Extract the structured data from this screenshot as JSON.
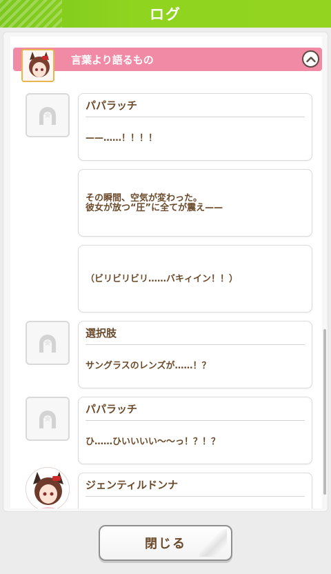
{
  "header": {
    "title": "ログ"
  },
  "chapter": {
    "title": "言葉より語るもの"
  },
  "entries": [
    {
      "speaker": "パパラッチ",
      "text": "——……！！！！"
    },
    {
      "speaker": "",
      "text": "その瞬間、空気が変わった。\n彼女が放つ“圧”に全てが震え——"
    },
    {
      "speaker": "",
      "text": "（ビリビリビリ……バキィイン！！）"
    },
    {
      "speaker": "選択肢",
      "text": "サングラスのレンズが……！？"
    },
    {
      "speaker": "パパラッチ",
      "text": "ひ……ひいいいい～～っ！？！？"
    },
    {
      "speaker": "ジェンティルドンナ",
      "text": ""
    }
  ],
  "footer": {
    "close_label": "閉じる"
  },
  "colors": {
    "header_green": "#8fd41f",
    "chapter_pink": "#f08aa5",
    "text_brown": "#6a4a2a"
  },
  "icons": {
    "toggle": "chevron-up-icon",
    "placeholder": "horseshoe-icon"
  }
}
